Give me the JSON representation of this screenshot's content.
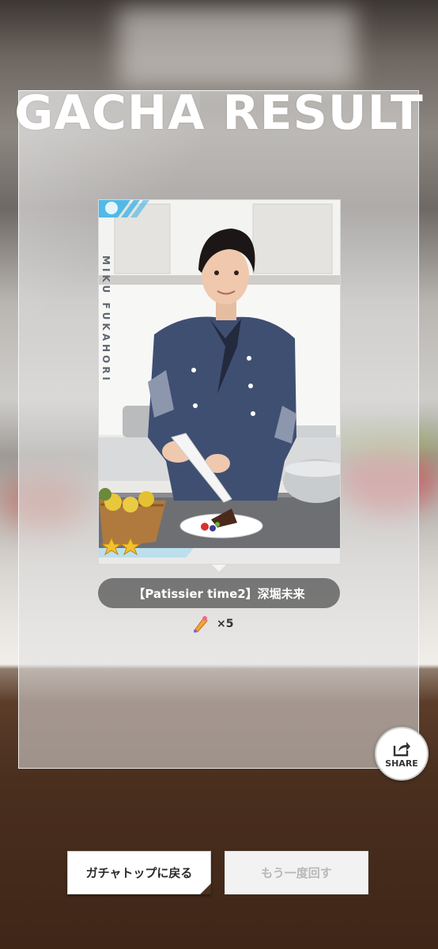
{
  "header": {
    "title": "GACHA RESULT"
  },
  "card": {
    "vertical_name": "MIKU FUKAHORI",
    "rarity_stars": 2
  },
  "result": {
    "name": "【Patissier time2】深堀未来",
    "reward_icon": "pastry-bag-icon",
    "reward_count": "×5"
  },
  "share": {
    "label": "SHARE",
    "icon": "share-icon"
  },
  "actions": {
    "back_label": "ガチャトップに戻る",
    "again_label": "もう一度回す"
  },
  "colors": {
    "pill_bg": "#646464",
    "card_accent": "#3fb4e6",
    "star": "#f5c02a"
  }
}
